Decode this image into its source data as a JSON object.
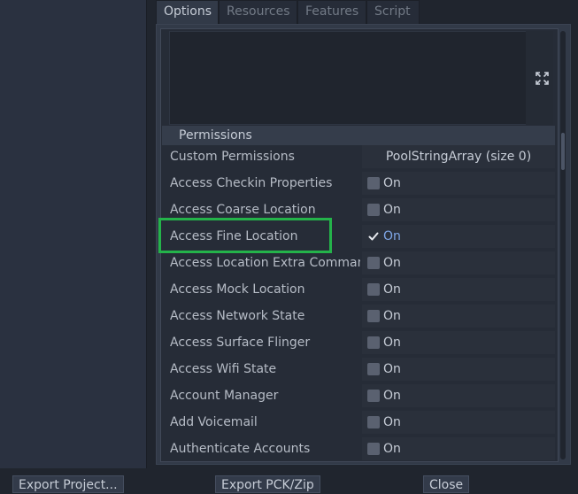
{
  "tabs": [
    {
      "label": "Options",
      "active": true
    },
    {
      "label": "Resources",
      "active": false
    },
    {
      "label": "Features",
      "active": false
    },
    {
      "label": "Script",
      "active": false
    }
  ],
  "section": {
    "title": "Permissions"
  },
  "custom_permissions": {
    "label": "Custom Permissions",
    "value": "PoolStringArray (size 0)"
  },
  "permissions": [
    {
      "label": "Access Checkin Properties",
      "value": "On",
      "checked": false
    },
    {
      "label": "Access Coarse Location",
      "value": "On",
      "checked": false
    },
    {
      "label": "Access Fine Location",
      "value": "On",
      "checked": true
    },
    {
      "label": "Access Location Extra Comman",
      "value": "On",
      "checked": false
    },
    {
      "label": "Access Mock Location",
      "value": "On",
      "checked": false
    },
    {
      "label": "Access Network State",
      "value": "On",
      "checked": false
    },
    {
      "label": "Access Surface Flinger",
      "value": "On",
      "checked": false
    },
    {
      "label": "Access Wifi State",
      "value": "On",
      "checked": false
    },
    {
      "label": "Account Manager",
      "value": "On",
      "checked": false
    },
    {
      "label": "Add Voicemail",
      "value": "On",
      "checked": false
    },
    {
      "label": "Authenticate Accounts",
      "value": "On",
      "checked": false
    }
  ],
  "footer": {
    "export_project": "Export Project...",
    "export_pck": "Export PCK/Zip",
    "close": "Close"
  },
  "highlight": {
    "target": "Access Fine Location",
    "color": "#24b34a"
  },
  "icons": {
    "expand": "expand-icon",
    "check": "check-icon"
  }
}
